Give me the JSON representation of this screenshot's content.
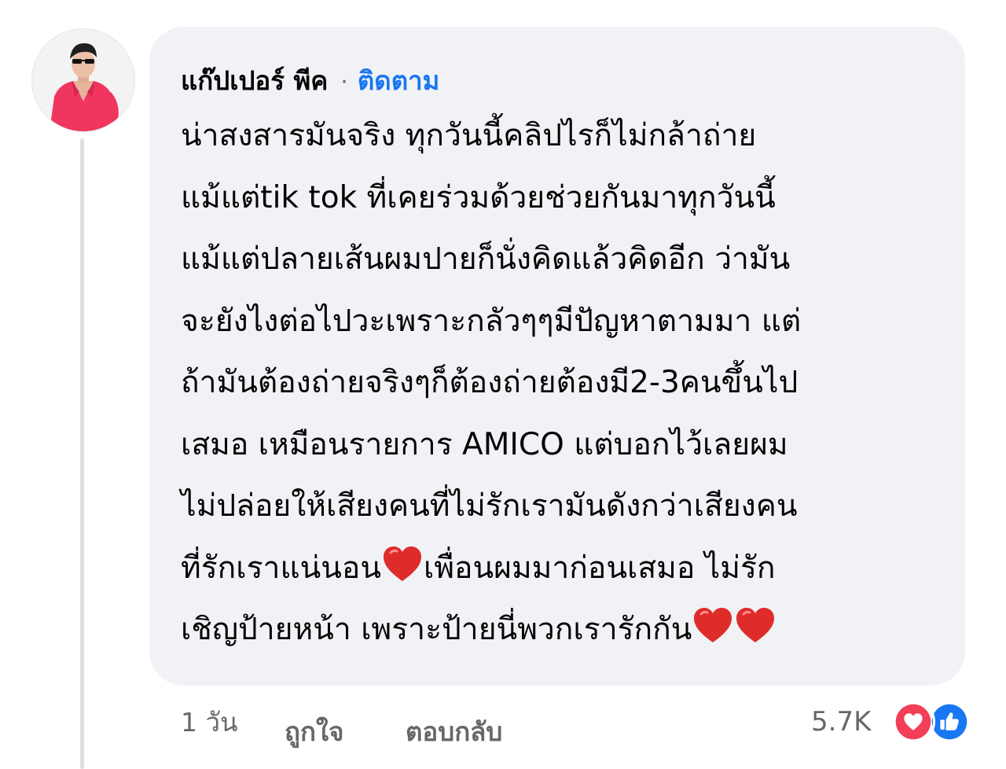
{
  "comment": {
    "author": "แก๊ปเปอร์ พีค",
    "separator": "·",
    "follow_label": "ติดตาม",
    "lines": [
      "น่าสงสารมันจริง ทุกวันนี้คลิปไรก็ไม่กล้าถ่าย",
      "แม้แต่tik tok ที่เคยร่วมด้วยช่วยกันมาทุกวันนี้",
      "แม้แต่ปลายเส้นผมปายก็นั่งคิดแล้วคิดอีก ว่ามัน",
      "จะยังไงต่อไปวะเพราะกลัวๆๆมีปัญหาตามมา แต่",
      "ถ้ามันต้องถ่ายจริงๆก็ต้องถ่ายต้องมี2-3คนขึ้นไป",
      "เสมอ เหมือนรายการ AMICO แต่บอกไว้เลยผม",
      "ไม่ปล่อยให้เสียงคนที่ไม่รักเรามันดังกว่าเสียงคน"
    ],
    "line8_part1": "ที่รักเราแน่นอน",
    "line8_part2": "เพื่อนผมมาก่อนเสมอ ไม่รัก",
    "line9_part1": "เชิญป้ายหน้า เพราะป้ายนี่พวกเรารักกัน",
    "emoji": "red-heart"
  },
  "footer": {
    "time": "1 วัน",
    "like_label": "ถูกใจ",
    "reply_label": "ตอบกลับ",
    "reaction_count": "5.7K",
    "reactions": [
      "love-icon",
      "like-icon"
    ]
  },
  "colors": {
    "bubble": "#f0f2f5",
    "link": "#1877f2",
    "love": "#f33e58",
    "like": "#1877f2",
    "muted": "#65676b"
  }
}
